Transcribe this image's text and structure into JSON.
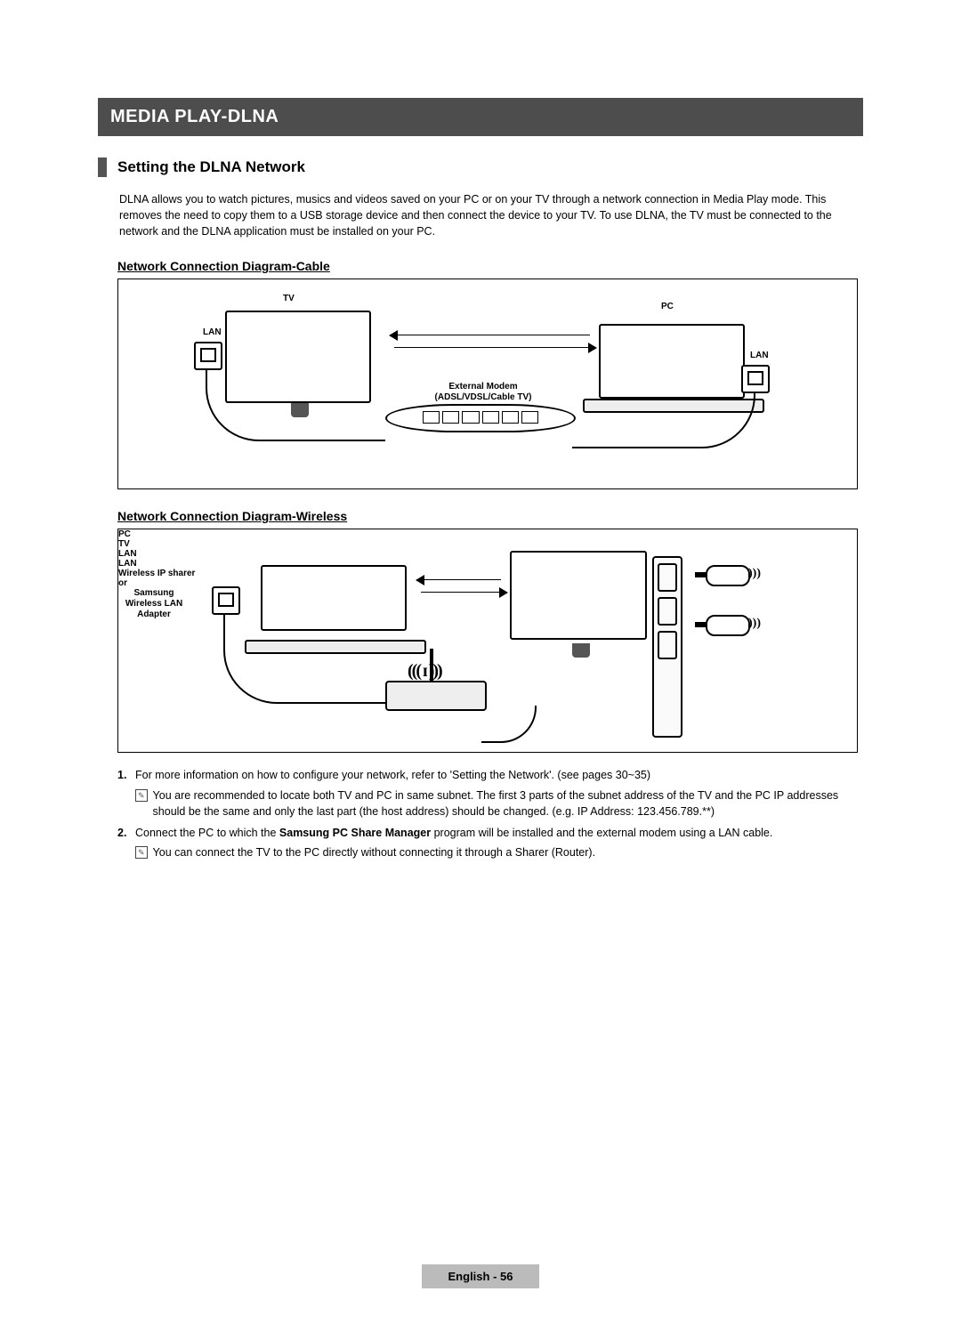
{
  "header": "MEDIA PLAY-DLNA",
  "section_title": "Setting the DLNA Network",
  "intro": "DLNA allows you to watch pictures, musics and videos saved on your PC or on your TV through a network connection in Media Play mode. This removes the need to copy them to a USB storage device and then connect the device to your TV. To use DLNA, the TV must be connected to the network and the DLNA application must be installed on your PC.",
  "diagram_cable": {
    "title": "Network Connection Diagram-Cable",
    "labels": {
      "tv": "TV",
      "pc": "PC",
      "lan_left": "LAN",
      "lan_right": "LAN",
      "modem_line1": "External Modem",
      "modem_line2": "(ADSL/VDSL/Cable TV)"
    }
  },
  "diagram_wireless": {
    "title": "Network Connection Diagram-Wireless",
    "labels": {
      "pc": "PC",
      "tv": "TV",
      "lan_pc": "LAN",
      "lan_bottom": "LAN",
      "router": "Wireless IP sharer",
      "or": "or",
      "adapter1": "Samsung",
      "adapter2": "Wireless LAN",
      "adapter3": "Adapter"
    }
  },
  "notes": {
    "n1_num": "1.",
    "n1_text": "For more information on how to configure your network, refer to 'Setting the Network'. (see pages 30~35)",
    "n1_sub_mark": "✎",
    "n1_sub_text": "You are recommended to locate both TV and PC in same subnet. The first 3 parts of the subnet address of the TV and the PC IP addresses should be the same and only the last part (the host address) should be changed. (e.g. IP Address: 123.456.789.**)",
    "n2_num": "2.",
    "n2_text_a": "Connect the PC to which the ",
    "n2_text_bold": "Samsung PC Share Manager",
    "n2_text_b": " program will be installed and the external modem using a LAN cable.",
    "n2_sub_mark": "✎",
    "n2_sub_text": "You can connect the TV to the PC directly without connecting it through a Sharer (Router)."
  },
  "footer": "English - 56"
}
